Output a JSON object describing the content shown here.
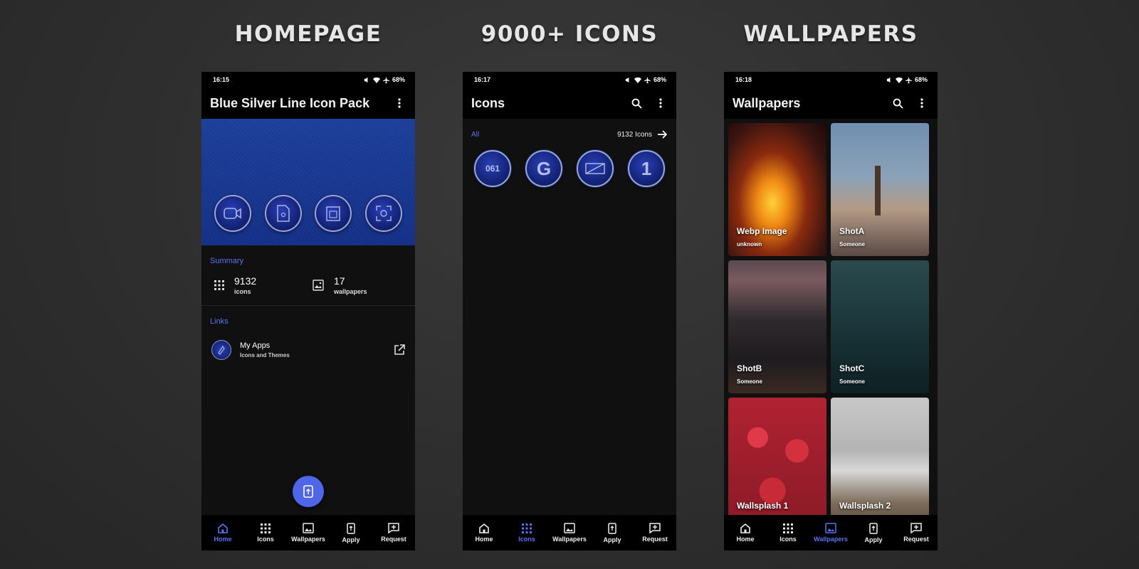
{
  "titles": {
    "left": "HOMEPAGE",
    "middle": "9000+ ICONS",
    "right": "WALLPAPERS"
  },
  "statusbar": {
    "time_home": "16:15",
    "time_icons": "16:17",
    "time_walls": "16:18",
    "battery": "68%"
  },
  "home": {
    "appbar_title": "Blue Silver Line Icon Pack",
    "summary_label": "Summary",
    "icons_count": "9132",
    "icons_sub": "icons",
    "wallpapers_count": "17",
    "wallpapers_sub": "wallpapers",
    "links_label": "Links",
    "link_title": "My Apps",
    "link_sub": "Icons and Themes"
  },
  "icons_screen": {
    "appbar_title": "Icons",
    "filter": "All",
    "count": "9132 Icons",
    "preview_texts": [
      "061",
      "G",
      "",
      "1"
    ]
  },
  "walls_screen": {
    "appbar_title": "Wallpapers",
    "cards": [
      {
        "title": "Webp Image",
        "author": "unknown"
      },
      {
        "title": "ShotA",
        "author": "Someone"
      },
      {
        "title": "ShotB",
        "author": "Someone"
      },
      {
        "title": "ShotC",
        "author": "Someone"
      },
      {
        "title": "Wallsplash 1",
        "author": ""
      },
      {
        "title": "Wallsplash 2",
        "author": ""
      }
    ]
  },
  "nav": {
    "home": "Home",
    "icons": "Icons",
    "wallpapers": "Wallpapers",
    "apply": "Apply",
    "request": "Request"
  },
  "colors": {
    "accent": "#5b72f0",
    "fab": "#4f66e8",
    "banner": "#1d3f9c"
  }
}
